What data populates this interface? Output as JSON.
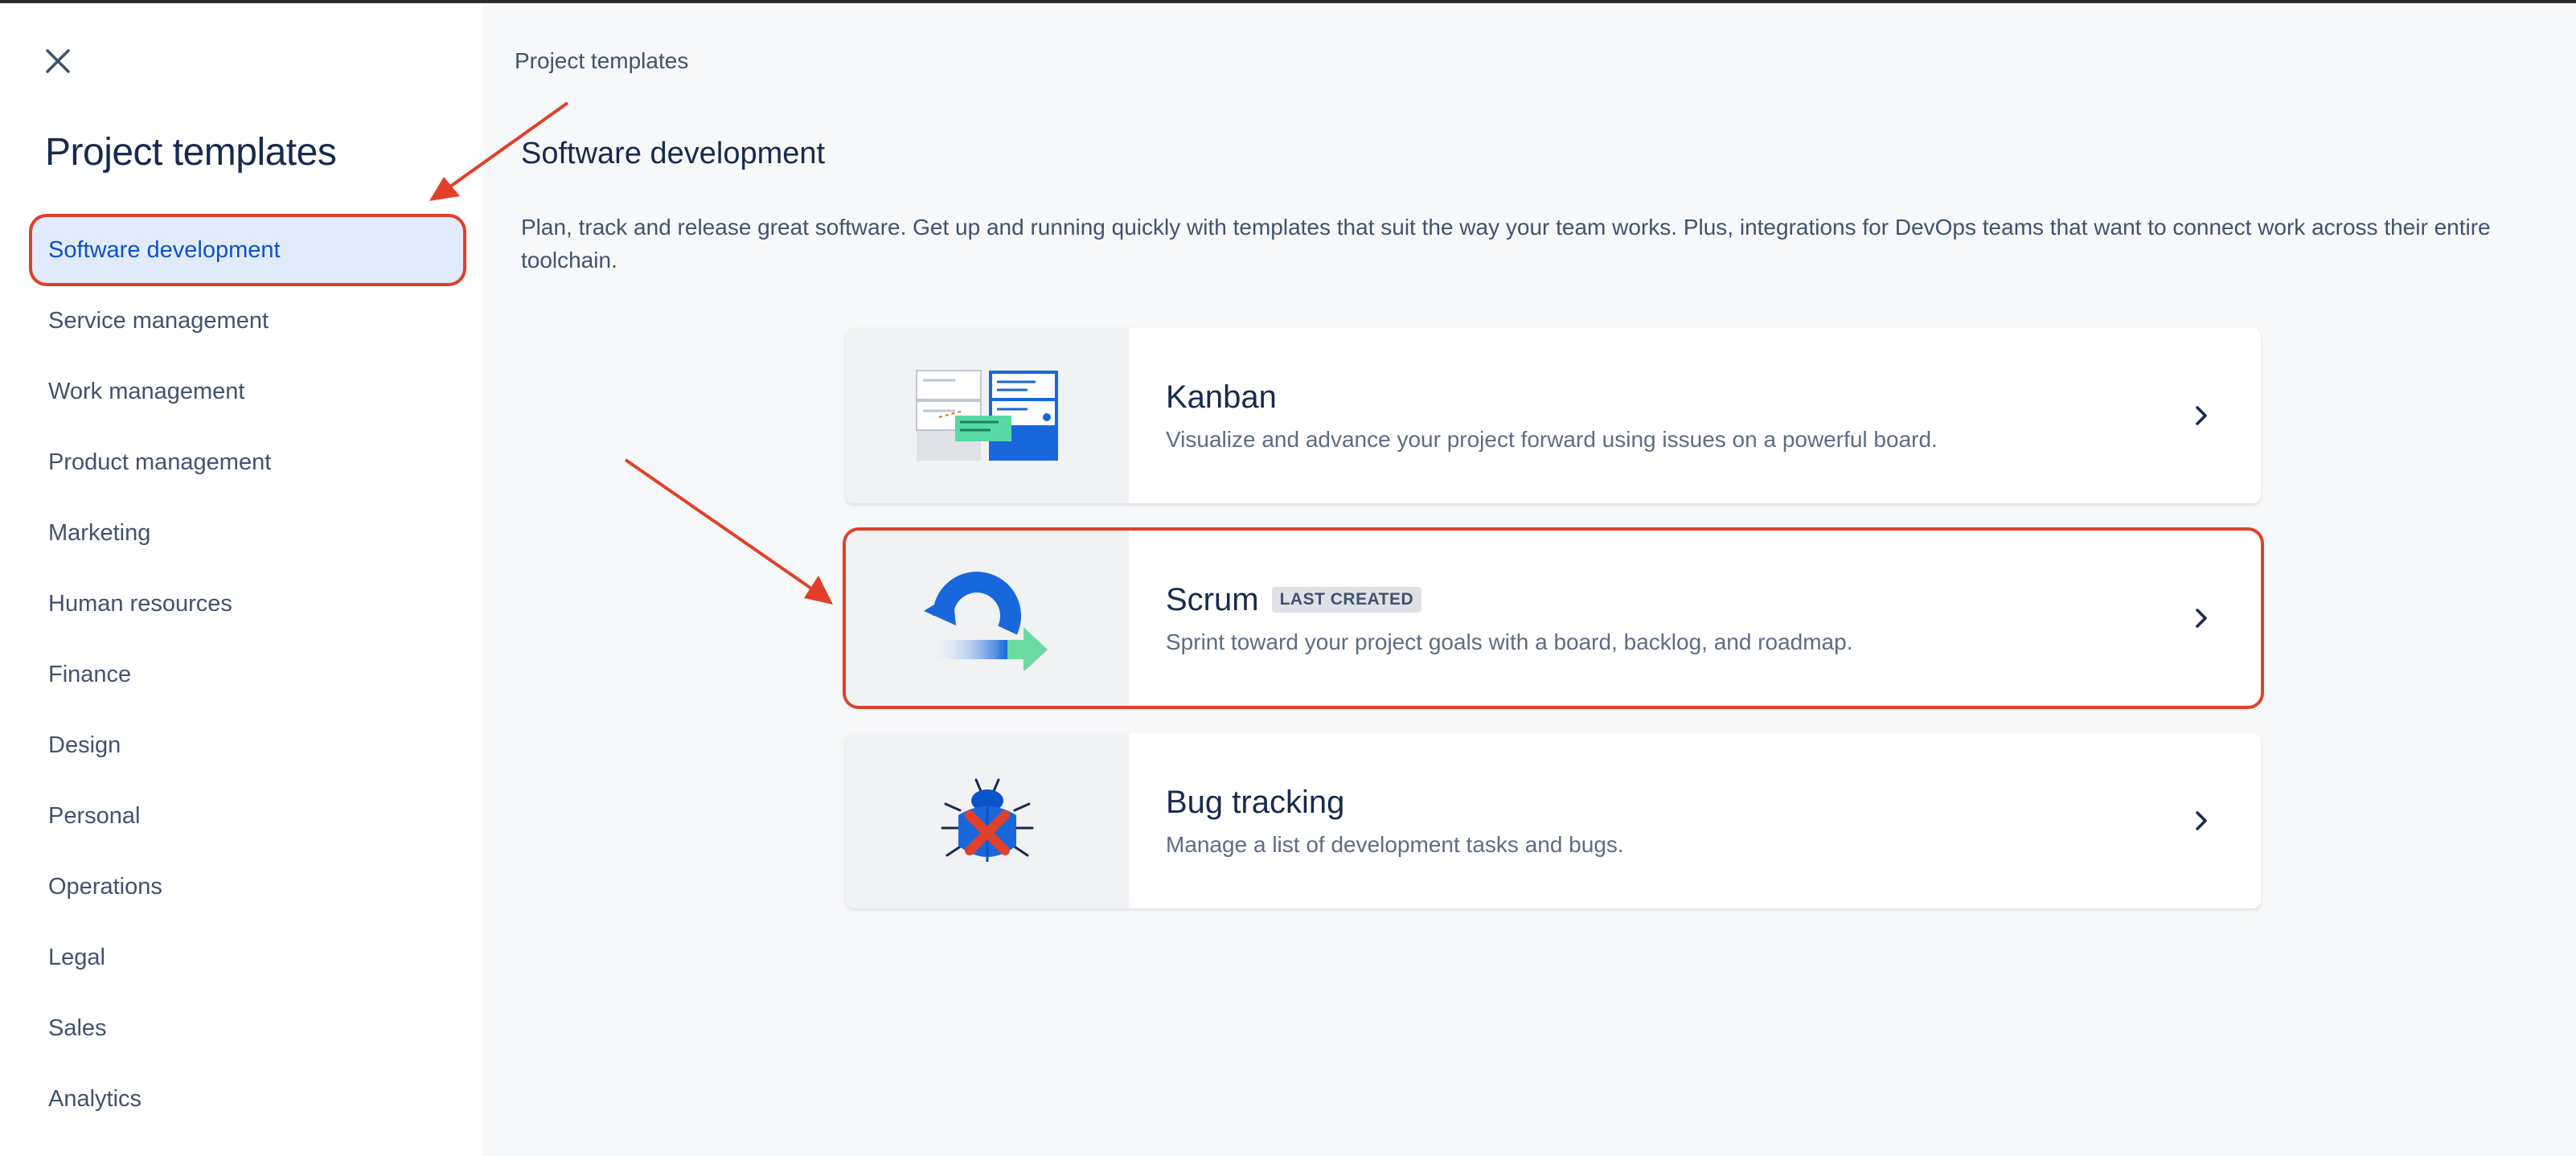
{
  "sidebar": {
    "title": "Project templates",
    "items": [
      {
        "label": "Software development",
        "active": true
      },
      {
        "label": "Service management"
      },
      {
        "label": "Work management"
      },
      {
        "label": "Product management"
      },
      {
        "label": "Marketing"
      },
      {
        "label": "Human resources"
      },
      {
        "label": "Finance"
      },
      {
        "label": "Design"
      },
      {
        "label": "Personal"
      },
      {
        "label": "Operations"
      },
      {
        "label": "Legal"
      },
      {
        "label": "Sales"
      },
      {
        "label": "Analytics"
      }
    ]
  },
  "main": {
    "breadcrumb": "Project templates",
    "title": "Software development",
    "description": "Plan, track and release great software. Get up and running quickly with templates that suit the way your team works. Plus, integrations for DevOps teams that want to connect work across their entire toolchain.",
    "templates": [
      {
        "title": "Kanban",
        "description": "Visualize and advance your project forward using issues on a powerful board.",
        "icon": "kanban-board-icon"
      },
      {
        "title": "Scrum",
        "badge": "LAST CREATED",
        "description": "Sprint toward your project goals with a board, backlog, and roadmap.",
        "icon": "scrum-cycle-icon",
        "highlighted": true
      },
      {
        "title": "Bug tracking",
        "description": "Manage a list of development tasks and bugs.",
        "icon": "bug-icon"
      }
    ]
  },
  "colors": {
    "accent": "#0c53c9",
    "active_bg": "#e2ebfb",
    "annotation": "#e0402a",
    "text_primary": "#172b4d",
    "text_secondary": "#42526e"
  }
}
